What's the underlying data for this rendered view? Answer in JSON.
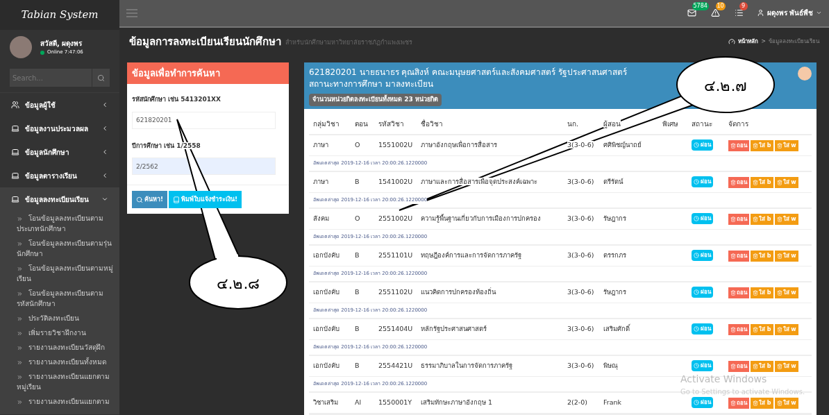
{
  "brand": "Tabian System",
  "user_panel": {
    "greeting": "สวัสดี, ผดุงพร",
    "status": "Online 7:47:06",
    "online": true
  },
  "sidebar_search": {
    "placeholder": "Search..."
  },
  "sidebar": {
    "items": [
      {
        "label": "ข้อมูลผู้ใช้",
        "kind": "users",
        "expanded": false
      },
      {
        "label": "ข้อมูลงานประมวลผล",
        "kind": "laptop",
        "expanded": false
      },
      {
        "label": "ข้อมูลนักศึกษา",
        "kind": "laptop",
        "expanded": false
      },
      {
        "label": "ข้อมูลตารางเรียน",
        "kind": "laptop",
        "expanded": false
      },
      {
        "label": "ข้อมูลลงทะเบียนเรียน",
        "kind": "laptop",
        "expanded": true,
        "children": [
          {
            "label": "โอนข้อมูลลงทะเบียนตามประเภทนักศึกษา"
          },
          {
            "label": "โอนข้อมูลลงทะเบียนตามรุ่นนักศึกษา"
          },
          {
            "label": "โอนข้อมูลลงทะเบียนตามหมู่เรียน"
          },
          {
            "label": "โอนข้อมูลลงทะเบียนตามรหัสนักศึกษา"
          },
          {
            "label": "ประวัติลงทะเบียน"
          },
          {
            "label": "เพิ่มรายวิชาฝึกงาน"
          },
          {
            "label": "รายงานลงทะเบียนวัสดุฝึก"
          },
          {
            "label": "รายงานลงทะเบียนทั้งหมด"
          },
          {
            "label": "รายงานลงทะเบียนแยกตามหมู่เรียน"
          },
          {
            "label": "รายงานลงทะเบียนแยกตาม"
          }
        ]
      }
    ]
  },
  "topbar": {
    "notifications": [
      {
        "kind": "mail",
        "count": "5784",
        "color": "#00a65a"
      },
      {
        "kind": "warning",
        "count": "10",
        "color": "#f39c12"
      },
      {
        "kind": "tasks",
        "count": "9",
        "color": "#dd4b39"
      }
    ],
    "user_name": "ผดุงพร พันธ์พืช"
  },
  "page": {
    "title": "ข้อมูลการลงทะเบียนเรียนนักศึกษา",
    "subtitle": "สำหรับนักศึกษามหาวิทยาลัยราชภัฏกำแพงเพชร",
    "breadcrumb": [
      "หน้าหลัก",
      ">",
      "ข้อมูลลงทะเบียนเรียน"
    ]
  },
  "search_panel": {
    "title": "ข้อมูลเพื่อทำการค้นหา",
    "fields": [
      {
        "label": "รหัสนักศึกษา เช่น 5413201XX",
        "value": "621820201",
        "autofilled": false
      },
      {
        "label": "ปีการศึกษา เช่น 1/2558",
        "value": "2/2562",
        "autofilled": true
      }
    ],
    "buttons": [
      {
        "label": "ค้นหา!",
        "kind": "search"
      },
      {
        "label": "พิมพ์ใบแจ้งชำระเงิน!",
        "kind": "print"
      }
    ]
  },
  "student_panel": {
    "title": "621820201 นายธนาธร คุณสิงห์ คณะมนุษยศาสตร์และสังคมศาสตร์ รัฐประศาสนศาสตร์ สถานะทางการศึกษา มาลงทะเบียน",
    "total_badge": "จำนวนหน่วยกิตลงทะเบียนทั้งหมด 23 หน่วยกิต"
  },
  "table": {
    "columns": [
      "กลุ่มวิชา",
      "ตอน",
      "รหัสวิชา",
      "ชื่อวิชา",
      "นก.",
      "ผู้สอน",
      "พิเศษ",
      "สถานะ",
      "จัดการ"
    ],
    "rows": [
      {
        "group": "ภาษา",
        "section": "O",
        "code": "1551002U",
        "name": "ภาษาอังกฤษเพื่อการสื่อสาร",
        "credits": "3(3-0-6)",
        "teacher": "ศศิพิชญ์นาถย์",
        "status": "ผ่อน",
        "actions": [
          {
            "label": "ถอน",
            "kind": "withdraw"
          },
          {
            "label": "ใส่ b",
            "kind": "grade"
          },
          {
            "label": "ใส่ w",
            "kind": "grade"
          }
        ],
        "updated": "อัพเดตล่าสุด 2019-12-16 เวลา 20:00:26.1220000"
      },
      {
        "group": "ภาษา",
        "section": "B",
        "code": "1541002U",
        "name": "ภาษาและการสื่อสารเพื่อจุดประสงค์เฉพาะ",
        "credits": "3(3-0-6)",
        "teacher": "ตรีรัตน์",
        "status": "ผ่อน",
        "actions": [
          {
            "label": "ถอน",
            "kind": "withdraw"
          },
          {
            "label": "ใส่ b",
            "kind": "grade"
          },
          {
            "label": "ใส่ w",
            "kind": "grade"
          }
        ],
        "updated": "อัพเดตล่าสุด 2019-12-16 เวลา 20:00:26.1220000"
      },
      {
        "group": "สังคม",
        "section": "O",
        "code": "2551002U",
        "name": "ความรู้พื้นฐานเกี่ยวกับการเมืองการปกครอง",
        "credits": "3(3-0-6)",
        "teacher": "รัษฎากร",
        "status": "ผ่อน",
        "actions": [
          {
            "label": "ถอน",
            "kind": "withdraw"
          },
          {
            "label": "ใส่ b",
            "kind": "grade"
          },
          {
            "label": "ใส่ w",
            "kind": "grade"
          }
        ],
        "updated": "อัพเดตล่าสุด 2019-12-16 เวลา 20:00:26.1220000"
      },
      {
        "group": "เอกบังคับ",
        "section": "B",
        "code": "2551101U",
        "name": "ทฤษฎีองค์การและการจัดการภาครัฐ",
        "credits": "3(3-0-6)",
        "teacher": "ตรรกภร",
        "status": "ผ่อน",
        "actions": [
          {
            "label": "ถอน",
            "kind": "withdraw"
          },
          {
            "label": "ใส่ b",
            "kind": "grade"
          },
          {
            "label": "ใส่ w",
            "kind": "grade"
          }
        ],
        "updated": "อัพเดตล่าสุด 2019-12-16 เวลา 20:00:26.1220000"
      },
      {
        "group": "เอกบังคับ",
        "section": "B",
        "code": "2551102U",
        "name": "แนวคิดการปกครองท้องถิ่น",
        "credits": "3(3-0-6)",
        "teacher": "รัษฎากร",
        "status": "ผ่อน",
        "actions": [
          {
            "label": "ถอน",
            "kind": "withdraw"
          },
          {
            "label": "ใส่ b",
            "kind": "grade"
          },
          {
            "label": "ใส่ w",
            "kind": "grade"
          }
        ],
        "updated": "อัพเดตล่าสุด 2019-12-16 เวลา 20:00:26.1220000"
      },
      {
        "group": "เอกบังคับ",
        "section": "B",
        "code": "2551404U",
        "name": "หลักรัฐประศาสนศาสตร์",
        "credits": "3(3-0-6)",
        "teacher": "เสริมศักดิ์",
        "status": "ผ่อน",
        "actions": [
          {
            "label": "ถอน",
            "kind": "withdraw"
          },
          {
            "label": "ใส่ b",
            "kind": "grade"
          },
          {
            "label": "ใส่ w",
            "kind": "grade"
          }
        ],
        "updated": "อัพเดตล่าสุด 2019-12-16 เวลา 20:00:26.1220000"
      },
      {
        "group": "เอกบังคับ",
        "section": "B",
        "code": "2554421U",
        "name": "ธรรมาภิบาลในการจัดการภาครัฐ",
        "credits": "3(3-0-6)",
        "teacher": "พิษณุ",
        "status": "ผ่อน",
        "actions": [
          {
            "label": "ถอน",
            "kind": "withdraw"
          },
          {
            "label": "ใส่ b",
            "kind": "grade"
          },
          {
            "label": "ใส่ w",
            "kind": "grade"
          }
        ],
        "updated": "อัพเดตล่าสุด 2019-12-16 เวลา 20:00:26.1220000"
      },
      {
        "group": "วิชาเสริม",
        "section": "Al",
        "code": "1550001Y",
        "name": "เสริมทักษะภาษาอังกฤษ 1",
        "credits": "2(2-0)",
        "teacher": "Frank",
        "status": "ผ่อน",
        "actions": [
          {
            "label": "ถอน",
            "kind": "withdraw"
          },
          {
            "label": "ใส่ b",
            "kind": "grade"
          },
          {
            "label": "ใส่ w",
            "kind": "grade"
          }
        ]
      }
    ]
  },
  "callouts": [
    {
      "label": "๔.๒.๗"
    },
    {
      "label": "๔.๒.๘"
    }
  ],
  "os_notice": {
    "title": "Activate Windows",
    "text": "Go to Settings to activate Windows."
  }
}
